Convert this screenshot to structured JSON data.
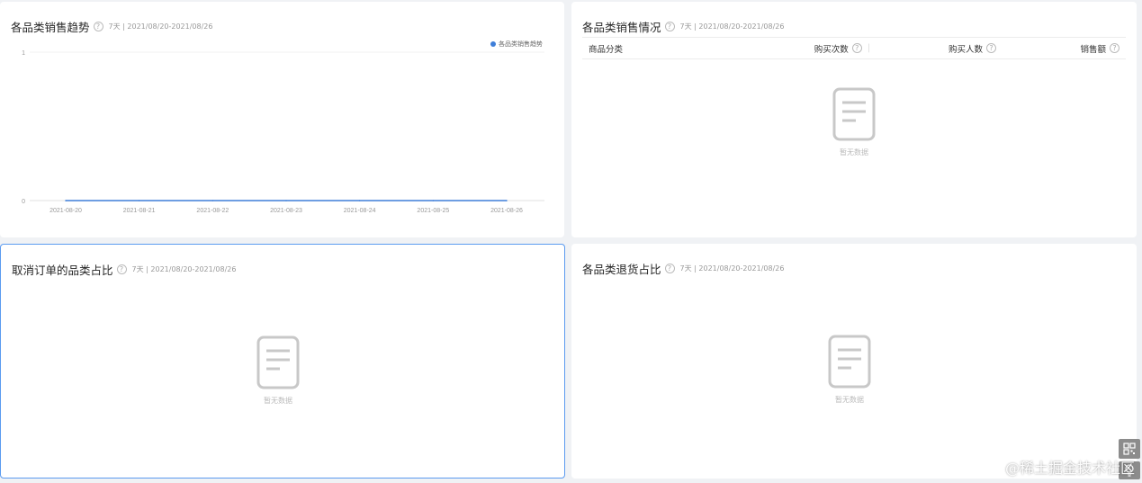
{
  "panels": {
    "trend": {
      "title": "各品类销售趋势",
      "range": "7天 | 2021/08/20-2021/08/26",
      "help": "?"
    },
    "sales": {
      "title": "各品类销售情况",
      "range": "7天 | 2021/08/20-2021/08/26",
      "help": "?",
      "columns": [
        "商品分类",
        "购买次数",
        "购买人数",
        "销售额"
      ],
      "empty_text": "暂无数据"
    },
    "cancel": {
      "title": "取消订单的品类占比",
      "range": "7天 | 2021/08/20-2021/08/26",
      "help": "?",
      "empty_text": "暂无数据"
    },
    "returns": {
      "title": "各品类退货占比",
      "range": "7天 | 2021/08/20-2021/08/26",
      "help": "?",
      "empty_text": "暂无数据"
    }
  },
  "chart_data": {
    "type": "line",
    "x": [
      "2021-08-20",
      "2021-08-21",
      "2021-08-22",
      "2021-08-23",
      "2021-08-24",
      "2021-08-25",
      "2021-08-26"
    ],
    "series": [
      {
        "name": "各品类销售趋势",
        "values": [
          0,
          0,
          0,
          0,
          0,
          0,
          0
        ],
        "color": "#3f7fd9"
      }
    ],
    "ylim": [
      0,
      1
    ],
    "yticks": [
      "0",
      "1"
    ],
    "grid": true,
    "legend": "top-right"
  },
  "watermark": "@稀土掘金技术社区",
  "icons": {
    "help": "question-circle-icon",
    "empty": "empty-document-icon",
    "qr": "qr-code-icon",
    "hint": "lightbulb-icon"
  }
}
